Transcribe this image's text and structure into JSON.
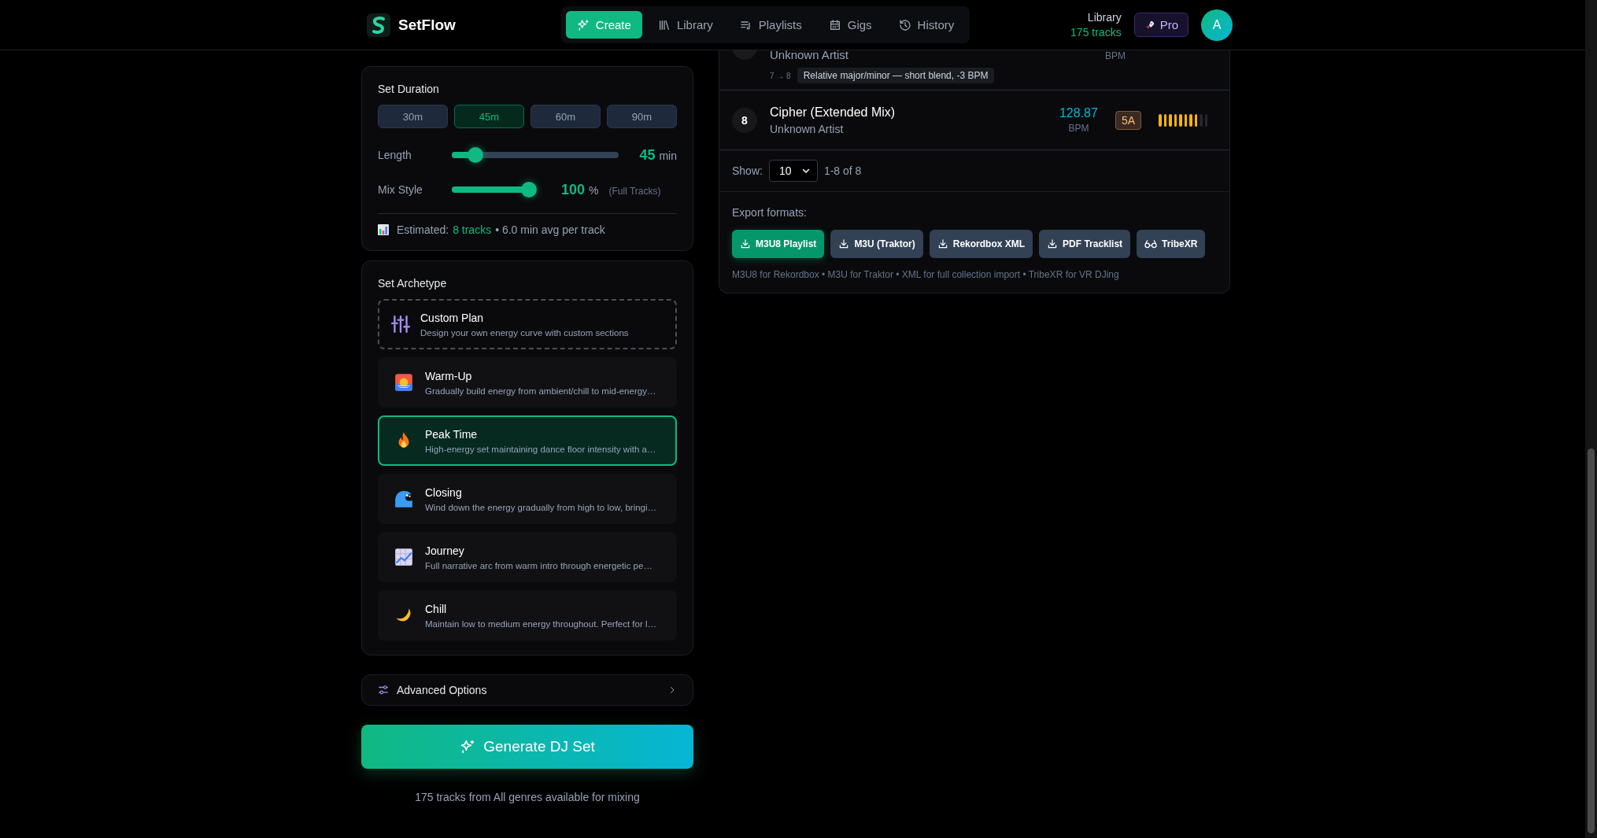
{
  "header": {
    "logo": "SetFlow",
    "nav": [
      {
        "label": "Create",
        "selected": true
      },
      {
        "label": "Library",
        "selected": false
      },
      {
        "label": "Playlists",
        "selected": false
      },
      {
        "label": "Gigs",
        "selected": false
      },
      {
        "label": "History",
        "selected": false
      }
    ],
    "library_label": "Library",
    "library_count": "175 tracks",
    "plan_badge": "Pro",
    "avatar": "A"
  },
  "duration": {
    "title": "Set Duration",
    "presets": [
      {
        "label": "30m",
        "selected": false
      },
      {
        "label": "45m",
        "selected": true
      },
      {
        "label": "60m",
        "selected": false
      },
      {
        "label": "90m",
        "selected": false
      }
    ],
    "length": {
      "label": "Length",
      "level": 0.14,
      "value": "45",
      "unit": "min"
    },
    "mix_style": {
      "label": "Mix Style",
      "level": 1,
      "value": "100",
      "unit": "%",
      "note": "(Full Tracks)"
    },
    "estimate": {
      "label": "Estimated:",
      "tracks": "8 tracks",
      "rest": "• 6.0 min avg per track"
    }
  },
  "archetypes": {
    "title": "Set Archetype",
    "items": [
      {
        "kind": "custom",
        "name": "Custom Plan",
        "description": "Design your own energy curve with custom sections",
        "selected": false
      },
      {
        "kind": "preset",
        "name": "Warm-Up",
        "description": "Gradually build energy from ambient/chill to mid-energy…",
        "selected": false
      },
      {
        "kind": "preset",
        "name": "Peak Time",
        "description": "High-energy set maintaining dance floor intensity with a…",
        "selected": true
      },
      {
        "kind": "preset",
        "name": "Closing",
        "description": "Wind down the energy gradually from high to low, bringi…",
        "selected": false
      },
      {
        "kind": "preset",
        "name": "Journey",
        "description": "Full narrative arc from warm intro through energetic pe…",
        "selected": false
      },
      {
        "kind": "preset",
        "name": "Chill",
        "description": "Maintain low to medium energy throughout. Perfect for l…",
        "selected": false
      }
    ]
  },
  "advanced": {
    "label": "Advanced Options",
    "expanded": false
  },
  "generate": {
    "label": "Generate DJ Set"
  },
  "footer_note": "175 tracks from All genres available for mixing",
  "tracklist": {
    "partial_row": {
      "artist": "Unknown Artist",
      "bpm_unit": "BPM",
      "transition": {
        "from_to": "7 → 8",
        "note": "Relative major/minor — short blend, -3 BPM"
      }
    },
    "rows": [
      {
        "number": "8",
        "title": "Cipher (Extended Mix)",
        "artist": "Unknown Artist",
        "bpm": "128.87",
        "bpm_unit": "BPM",
        "key": "5A",
        "energy": {
          "level": 0.8
        }
      }
    ],
    "pagination": {
      "label": "Show:",
      "page_size": "10",
      "range": "1-8 of 8"
    },
    "export": {
      "title": "Export formats:",
      "buttons": [
        {
          "label": "M3U8 Playlist",
          "kind": "download",
          "selected": true
        },
        {
          "label": "M3U (Traktor)",
          "kind": "download",
          "selected": false
        },
        {
          "label": "Rekordbox XML",
          "kind": "download",
          "selected": false
        },
        {
          "label": "PDF Tracklist",
          "kind": "download",
          "selected": false
        },
        {
          "label": "TribeXR",
          "kind": "vr",
          "selected": false
        }
      ],
      "note": "M3U8 for Rekordbox • M3U for Traktor • XML for full collection import • TribeXR for VR DJing"
    }
  }
}
